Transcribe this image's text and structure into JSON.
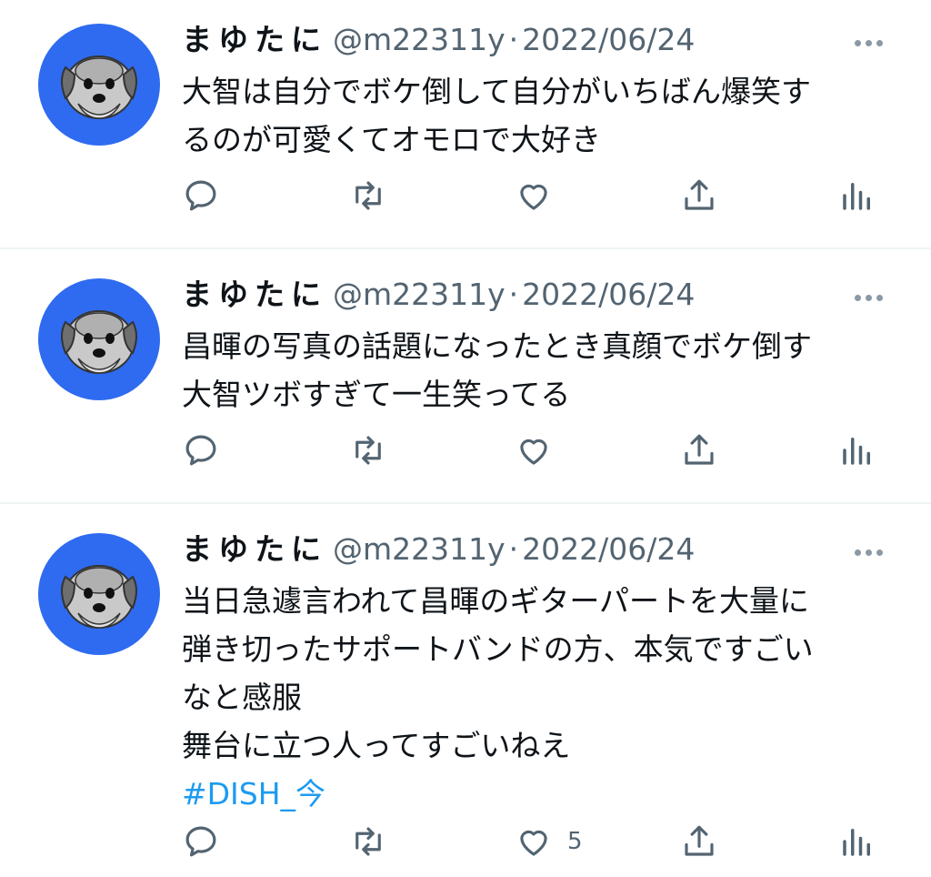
{
  "tweets": [
    {
      "author": "まゆたに",
      "handle": "@m22311y",
      "separator": "·",
      "date": "2022/06/24",
      "lines": [
        "大智は自分でボケ倒して自分がいちばん爆笑す",
        "るのが可愛くてオモロで大好き"
      ],
      "hashtag": "",
      "actions": {
        "reply": "",
        "retweet": "",
        "like": "",
        "share": "",
        "analytics": ""
      }
    },
    {
      "author": "まゆたに",
      "handle": "@m22311y",
      "separator": "·",
      "date": "2022/06/24",
      "lines": [
        "昌暉の写真の話題になったとき真顔でボケ倒す",
        "大智ツボすぎて一生笑ってる"
      ],
      "hashtag": "",
      "actions": {
        "reply": "",
        "retweet": "",
        "like": "",
        "share": "",
        "analytics": ""
      }
    },
    {
      "author": "まゆたに",
      "handle": "@m22311y",
      "separator": "·",
      "date": "2022/06/24",
      "lines": [
        "当日急遽言われて昌暉のギターパートを大量に",
        "弾き切ったサポートバンドの方、本気ですごい",
        "なと感服",
        "舞台に立つ人ってすごいねえ"
      ],
      "hashtag": "#DISH_今",
      "actions": {
        "reply": "",
        "retweet": "",
        "like": "5",
        "share": "",
        "analytics": ""
      }
    }
  ],
  "icons": {
    "avatar": "schnauzer-dog-avatar",
    "more": "more-dots-icon",
    "reply": "reply-bubble-icon",
    "retweet": "retweet-icon",
    "like": "heart-icon",
    "share": "share-upload-icon",
    "analytics": "analytics-bars-icon"
  },
  "colors": {
    "text": "#0f1419",
    "secondary": "#536471",
    "link": "#1d9bf0",
    "avatar_bg": "#2f6bf0",
    "divider": "#eff3f4"
  }
}
